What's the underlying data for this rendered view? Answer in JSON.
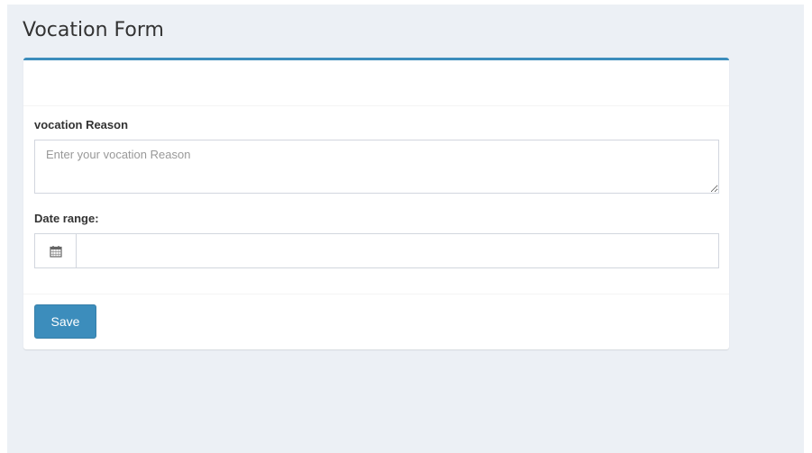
{
  "page": {
    "title": "Vocation Form"
  },
  "form": {
    "reason_label": "vocation Reason",
    "reason_placeholder": "Enter your vocation Reason",
    "reason_value": "",
    "date_label": "Date range:",
    "date_value": "",
    "date_icon": "calendar-icon",
    "save_label": "Save"
  },
  "colors": {
    "background": "#ecf0f5",
    "accent": "#3c8dbc",
    "panel": "#ffffff"
  }
}
